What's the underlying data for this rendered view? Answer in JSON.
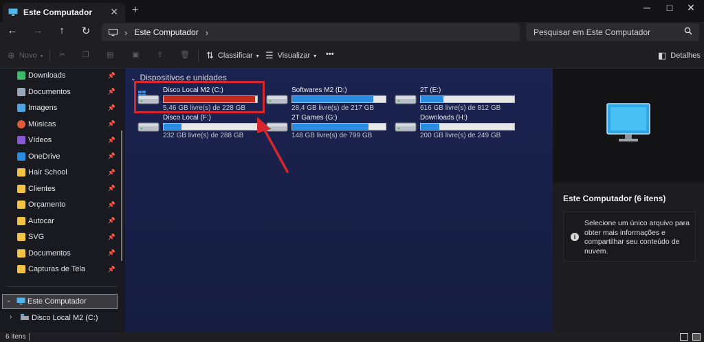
{
  "window": {
    "tab_title": "Este Computador",
    "minimize": "─",
    "maximize": "□",
    "close": "✕"
  },
  "nav": {
    "breadcrumb": "Este Computador",
    "search_placeholder": "Pesquisar em Este Computador"
  },
  "toolbar": {
    "new_label": "Novo",
    "sort_label": "Classificar",
    "view_label": "Visualizar",
    "more_label": "•••",
    "details_label": "Detalhes"
  },
  "sidebar": {
    "items": [
      {
        "label": "Downloads",
        "icon": "download-icon",
        "pinned": true
      },
      {
        "label": "Documentos",
        "icon": "document-icon",
        "pinned": true
      },
      {
        "label": "Imagens",
        "icon": "image-icon",
        "pinned": true
      },
      {
        "label": "Músicas",
        "icon": "music-icon",
        "pinned": true
      },
      {
        "label": "Vídeos",
        "icon": "video-icon",
        "pinned": true
      },
      {
        "label": "OneDrive",
        "icon": "cloud-icon",
        "pinned": true
      },
      {
        "label": "Hair School",
        "icon": "folder-icon",
        "pinned": true
      },
      {
        "label": "Clientes",
        "icon": "folder-icon",
        "pinned": true
      },
      {
        "label": "Orçamento",
        "icon": "folder-icon",
        "pinned": true
      },
      {
        "label": "Autocar",
        "icon": "folder-icon",
        "pinned": true
      },
      {
        "label": "SVG",
        "icon": "folder-icon",
        "pinned": true
      },
      {
        "label": "Documentos",
        "icon": "folder-icon",
        "pinned": true
      },
      {
        "label": "Capturas de Tela",
        "icon": "folder-icon",
        "pinned": true
      }
    ],
    "this_pc": "Este Computador",
    "drive_c": "Disco Local M2 (C:)"
  },
  "main": {
    "group_title": "Dispositivos e unidades",
    "drives": [
      {
        "name": "Disco Local M2 (C:)",
        "free": "5,46 GB livre(s) de 228 GB",
        "used_fraction": 0.976,
        "color": "#c42b1c",
        "windows": true
      },
      {
        "name": "Softwares M2 (D:)",
        "free": "28,4 GB livre(s) de 217 GB",
        "used_fraction": 0.869,
        "color": "#2a8ce0",
        "windows": false
      },
      {
        "name": "2T (E:)",
        "free": "616 GB livre(s) de 812 GB",
        "used_fraction": 0.241,
        "color": "#2a8ce0",
        "windows": false
      },
      {
        "name": "Disco Local (F:)",
        "free": "232 GB livre(s) de 288 GB",
        "used_fraction": 0.194,
        "color": "#2a8ce0",
        "windows": false
      },
      {
        "name": "2T Games (G:)",
        "free": "148 GB livre(s) de 799 GB",
        "used_fraction": 0.815,
        "color": "#2a8ce0",
        "windows": false
      },
      {
        "name": "Downloads (H:)",
        "free": "200 GB livre(s) de 249 GB",
        "used_fraction": 0.197,
        "color": "#2a8ce0",
        "windows": false
      }
    ]
  },
  "details": {
    "title": "Este Computador (6 itens)",
    "message": "Selecione um único arquivo para obter mais informações e compartilhar seu conteúdo de nuvem."
  },
  "status": {
    "count": "6 itens"
  }
}
